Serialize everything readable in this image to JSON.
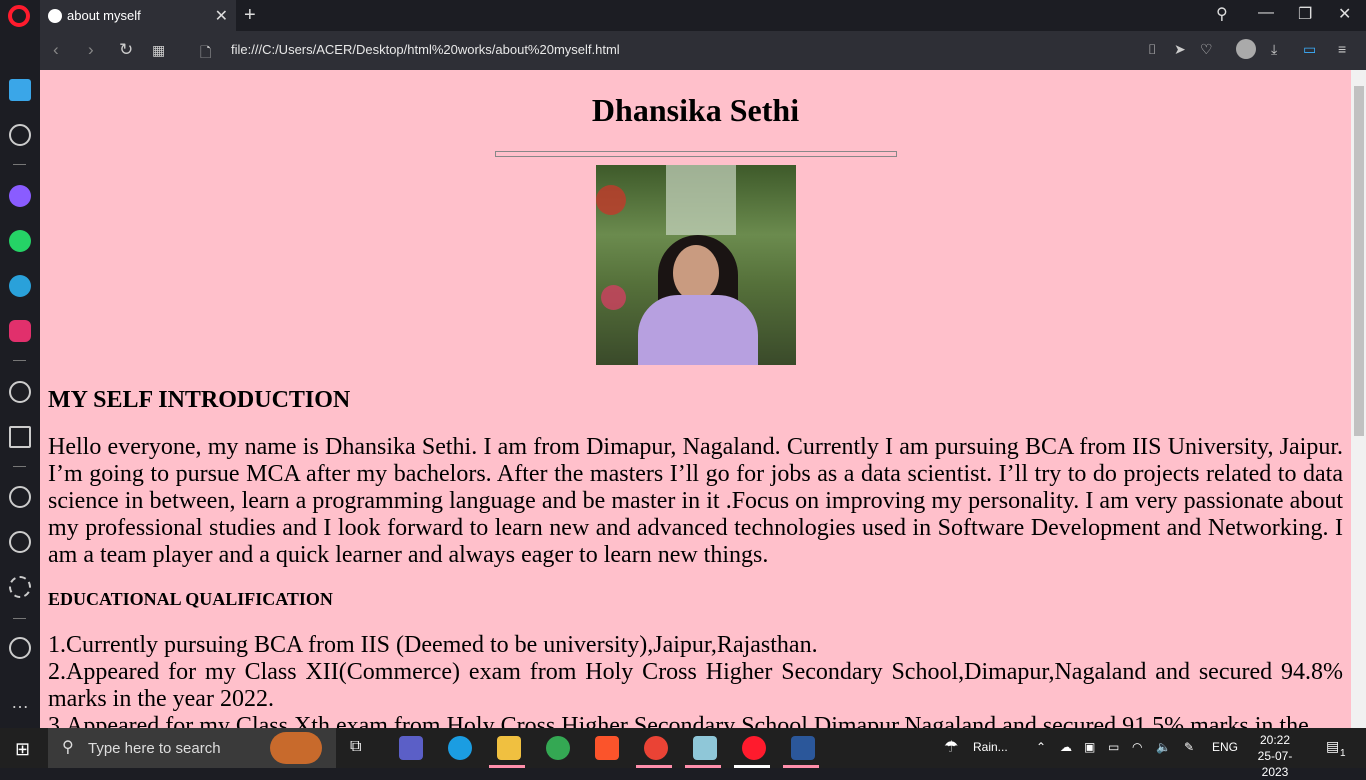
{
  "browser": {
    "tab_title": "about myself",
    "url": "file:///C:/Users/ACER/Desktop/html%20works/about%20myself.html"
  },
  "page": {
    "name": "Dhansika Sethi",
    "photo_alt": "profile photo",
    "intro_heading": "MY SELF INTRODUCTION",
    "intro_text": "Hello everyone, my name is Dhansika Sethi. I am from Dimapur, Nagaland. Currently I am pursuing BCA from IIS University, Jaipur. I’m going to pursue MCA after my bachelors. After the masters I’ll go for jobs as a data scientist. I’ll try to do projects related to data science in between, learn a programming language and be master in it .Focus on improving my personality. I am very passionate about my professional studies and I look forward to learn new and advanced technologies used in Software Development and Networking. I am a team player and a quick learner and always eager to learn new things.",
    "edu_heading": "EDUCATIONAL QUALIFICATION",
    "edu_items": [
      "1.Currently pursuing BCA from IIS (Deemed to be university),Jaipur,Rajasthan.",
      "2.Appeared for my Class XII(Commerce) exam from Holy Cross Higher Secondary School,Dimapur,Nagaland and secured 94.8% marks in the year 2022.",
      "3.Appeared for my Class Xth exam from Holy Cross Higher Secondary School,Dimapur,Nagaland and secured 91.5% marks in the"
    ]
  },
  "taskbar": {
    "search_placeholder": "Type here to search",
    "weather": "Rain...",
    "language": "ENG",
    "time": "20:22",
    "date": "25-07-2023",
    "notification_count": "1"
  }
}
